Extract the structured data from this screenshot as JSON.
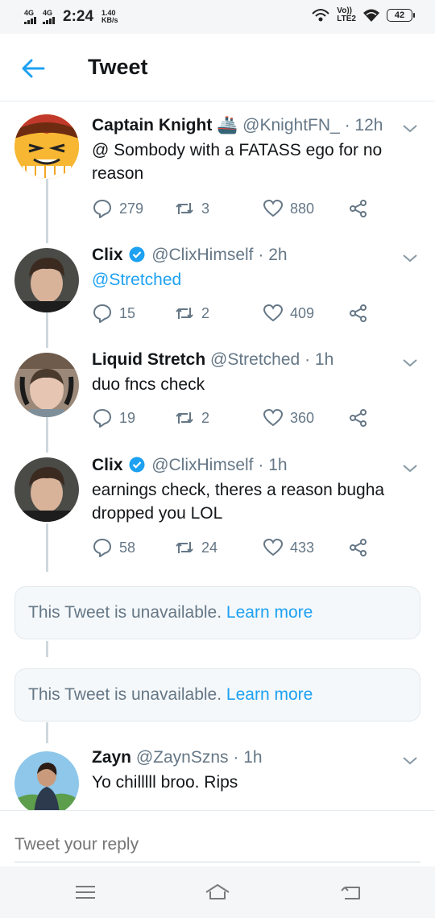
{
  "status_bar": {
    "sim1": "4G",
    "sim2": "4G",
    "time": "2:24",
    "speed_value": "1.40",
    "speed_unit": "KB/s",
    "volte_top": "Vo))",
    "volte_bottom": "LTE2",
    "battery": "42"
  },
  "header": {
    "title": "Tweet",
    "back_icon": "arrow-left-icon"
  },
  "tweets": [
    {
      "name": "Captain Knight",
      "emoji": "🚢",
      "handle": "@KnightFN_",
      "time": "· 12h",
      "text": "@ Sombody with a FATASS ego for no reason",
      "replies": "279",
      "retweets": "3",
      "likes": "880",
      "verified": false
    },
    {
      "name": "Clix",
      "handle": "@ClixHimself",
      "time": "· 2h",
      "text": "@Stretched",
      "replies": "15",
      "retweets": "2",
      "likes": "409",
      "verified": true
    },
    {
      "name": "Liquid Stretch",
      "handle": "@Stretched",
      "time": "· 1h",
      "text": "duo fncs check",
      "replies": "19",
      "retweets": "2",
      "likes": "360",
      "verified": false
    },
    {
      "name": "Clix",
      "handle": "@ClixHimself",
      "time": "· 1h",
      "text": "earnings check, theres a reason bugha dropped you LOL",
      "replies": "58",
      "retweets": "24",
      "likes": "433",
      "verified": true
    },
    {
      "name": "Zayn",
      "handle": "@ZaynSzns",
      "time": "· 1h",
      "text": "Yo chilllll broo. Rips",
      "verified": false
    }
  ],
  "unavailable": [
    {
      "text": "This Tweet is unavailable.",
      "link": "Learn more"
    },
    {
      "text": "This Tweet is unavailable.",
      "link": "Learn more"
    }
  ],
  "reply": {
    "placeholder": "Tweet your reply"
  },
  "colors": {
    "accent": "#1da1f2",
    "secondary_text": "#657786",
    "primary_text": "#14171a"
  }
}
